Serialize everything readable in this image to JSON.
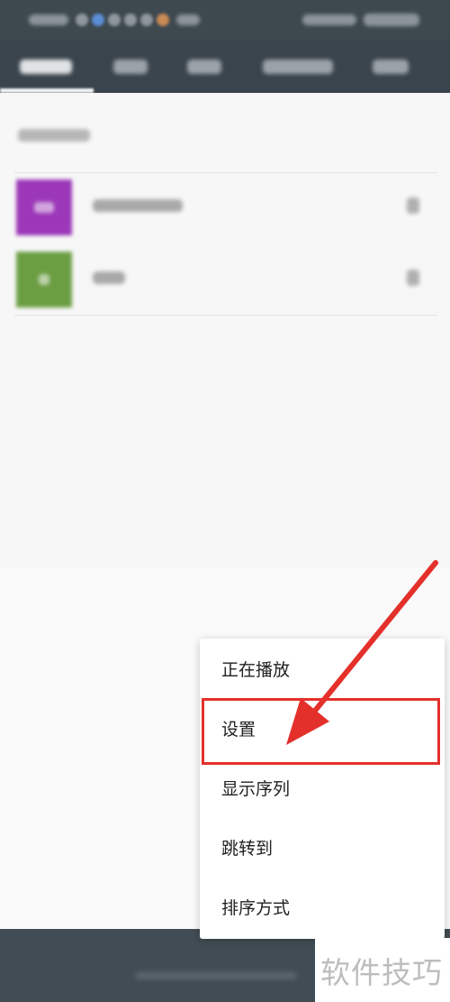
{
  "menu": {
    "items": [
      {
        "label": "正在播放"
      },
      {
        "label": "设置"
      },
      {
        "label": "显示序列"
      },
      {
        "label": "跳转到"
      },
      {
        "label": "排序方式"
      }
    ],
    "highlighted_item": "设置"
  },
  "library": {
    "items": [
      {
        "thumbnail_color": "#9b37b8"
      },
      {
        "thumbnail_color": "#6b9e43"
      }
    ]
  },
  "annotation": {
    "color": "#e4302b"
  },
  "watermark": {
    "text": "软件技巧"
  },
  "theme": {
    "top_bar_color": "#3a444c",
    "menu_background": "#ffffff",
    "content_background": "#f7f7f7"
  }
}
